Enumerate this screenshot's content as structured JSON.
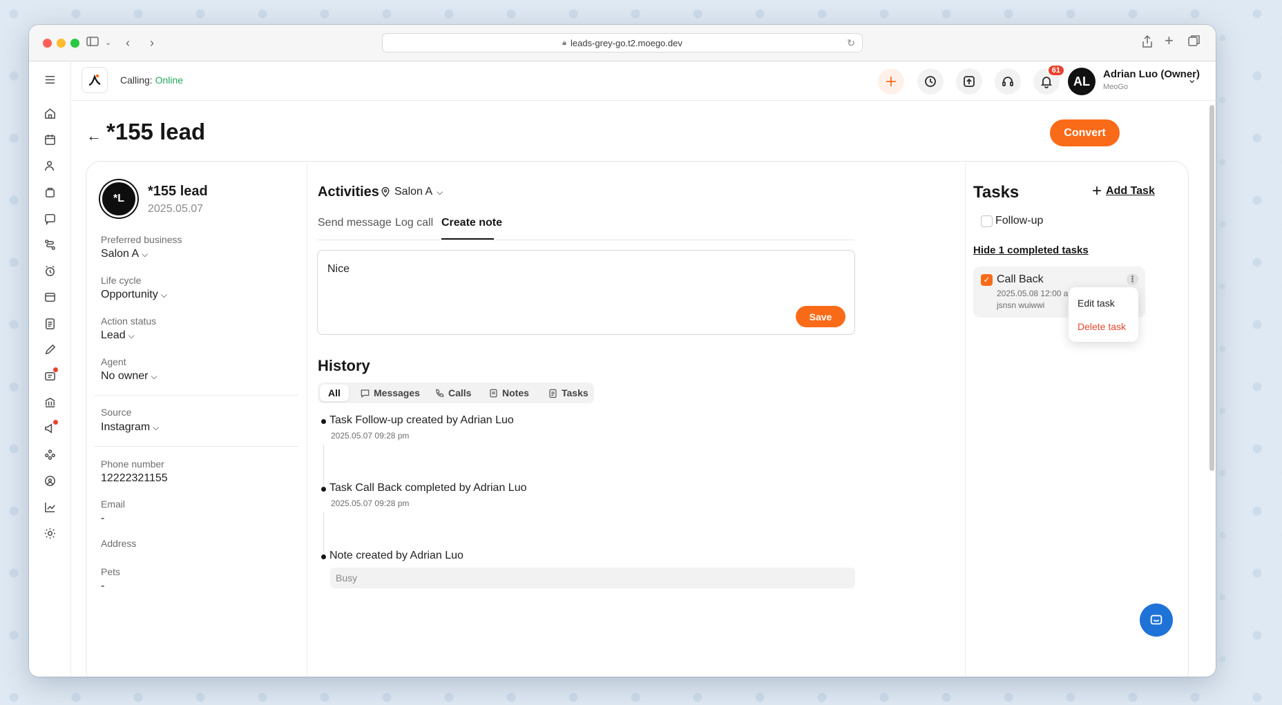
{
  "browser": {
    "url": "leads-grey-go.t2.moego.dev"
  },
  "topbar": {
    "calling_label": "Calling:",
    "calling_status": "Online",
    "notification_count": "61",
    "user_initials": "AL",
    "user_name": "Adrian Luo (Owner)",
    "user_org": "MeoGo"
  },
  "page": {
    "title": "*155 lead",
    "convert_label": "Convert"
  },
  "lead": {
    "initials": "*L",
    "name": "*155 lead",
    "date": "2025.05.07",
    "fields": {
      "preferred_business_label": "Preferred business",
      "preferred_business_value": "Salon A",
      "life_cycle_label": "Life cycle",
      "life_cycle_value": "Opportunity",
      "action_status_label": "Action status",
      "action_status_value": "Lead",
      "agent_label": "Agent",
      "agent_value": "No owner",
      "source_label": "Source",
      "source_value": "Instagram",
      "phone_label": "Phone number",
      "phone_value": "12222321155",
      "email_label": "Email",
      "email_value": "-",
      "address_label": "Address",
      "pets_label": "Pets",
      "pets_value": "-"
    }
  },
  "activities": {
    "title": "Activities",
    "location": "Salon A",
    "tabs": [
      "Send message",
      "Log call",
      "Create note"
    ],
    "note_text": "Nice",
    "save_label": "Save"
  },
  "history": {
    "title": "History",
    "filters": [
      "All",
      "Messages",
      "Calls",
      "Notes",
      "Tasks"
    ],
    "items": [
      {
        "text": "Task Follow-up created by Adrian Luo",
        "time": "2025.05.07 09:28 pm"
      },
      {
        "text": "Task Call Back completed by Adrian Luo",
        "time": "2025.05.07 09:28 pm"
      },
      {
        "text": "Note created by Adrian Luo",
        "note": "Busy"
      }
    ]
  },
  "tasks": {
    "title": "Tasks",
    "add_label": "Add Task",
    "open": [
      {
        "label": "Follow-up"
      }
    ],
    "hide_completed_label": "Hide 1 completed tasks",
    "completed": {
      "label": "Call Back",
      "due": "2025.05.08 12:00 am",
      "assignee": "jsnsn wuiwwi"
    },
    "menu": {
      "edit": "Edit task",
      "delete": "Delete task"
    }
  },
  "colors": {
    "accent": "#f96b18",
    "online": "#22a85a",
    "danger": "#e5472d",
    "chat_fab": "#1f73d6"
  }
}
